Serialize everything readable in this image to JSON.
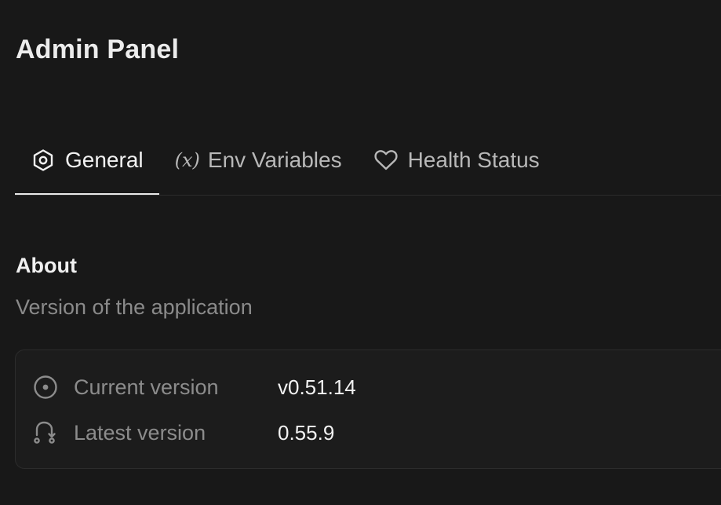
{
  "header": {
    "title": "Admin Panel"
  },
  "tabs": [
    {
      "label": "General",
      "icon": "hexagon-settings-icon",
      "active": true
    },
    {
      "label": "Env Variables",
      "icon": "variable-x-icon",
      "icon_text": "(x)",
      "active": false
    },
    {
      "label": "Health Status",
      "icon": "heart-icon",
      "active": false
    }
  ],
  "about": {
    "title": "About",
    "subtitle": "Version of the application",
    "rows": [
      {
        "label": "Current version",
        "value": "v0.51.14",
        "icon": "circle-dot-icon"
      },
      {
        "label": "Latest version",
        "value": "0.55.9",
        "icon": "git-pull-request-icon"
      }
    ]
  },
  "colors": {
    "background": "#181818",
    "card_border": "#2c2c2c",
    "text_primary": "#ececec",
    "text_muted": "#8a8a8a",
    "active_underline": "#e8e8e8"
  }
}
